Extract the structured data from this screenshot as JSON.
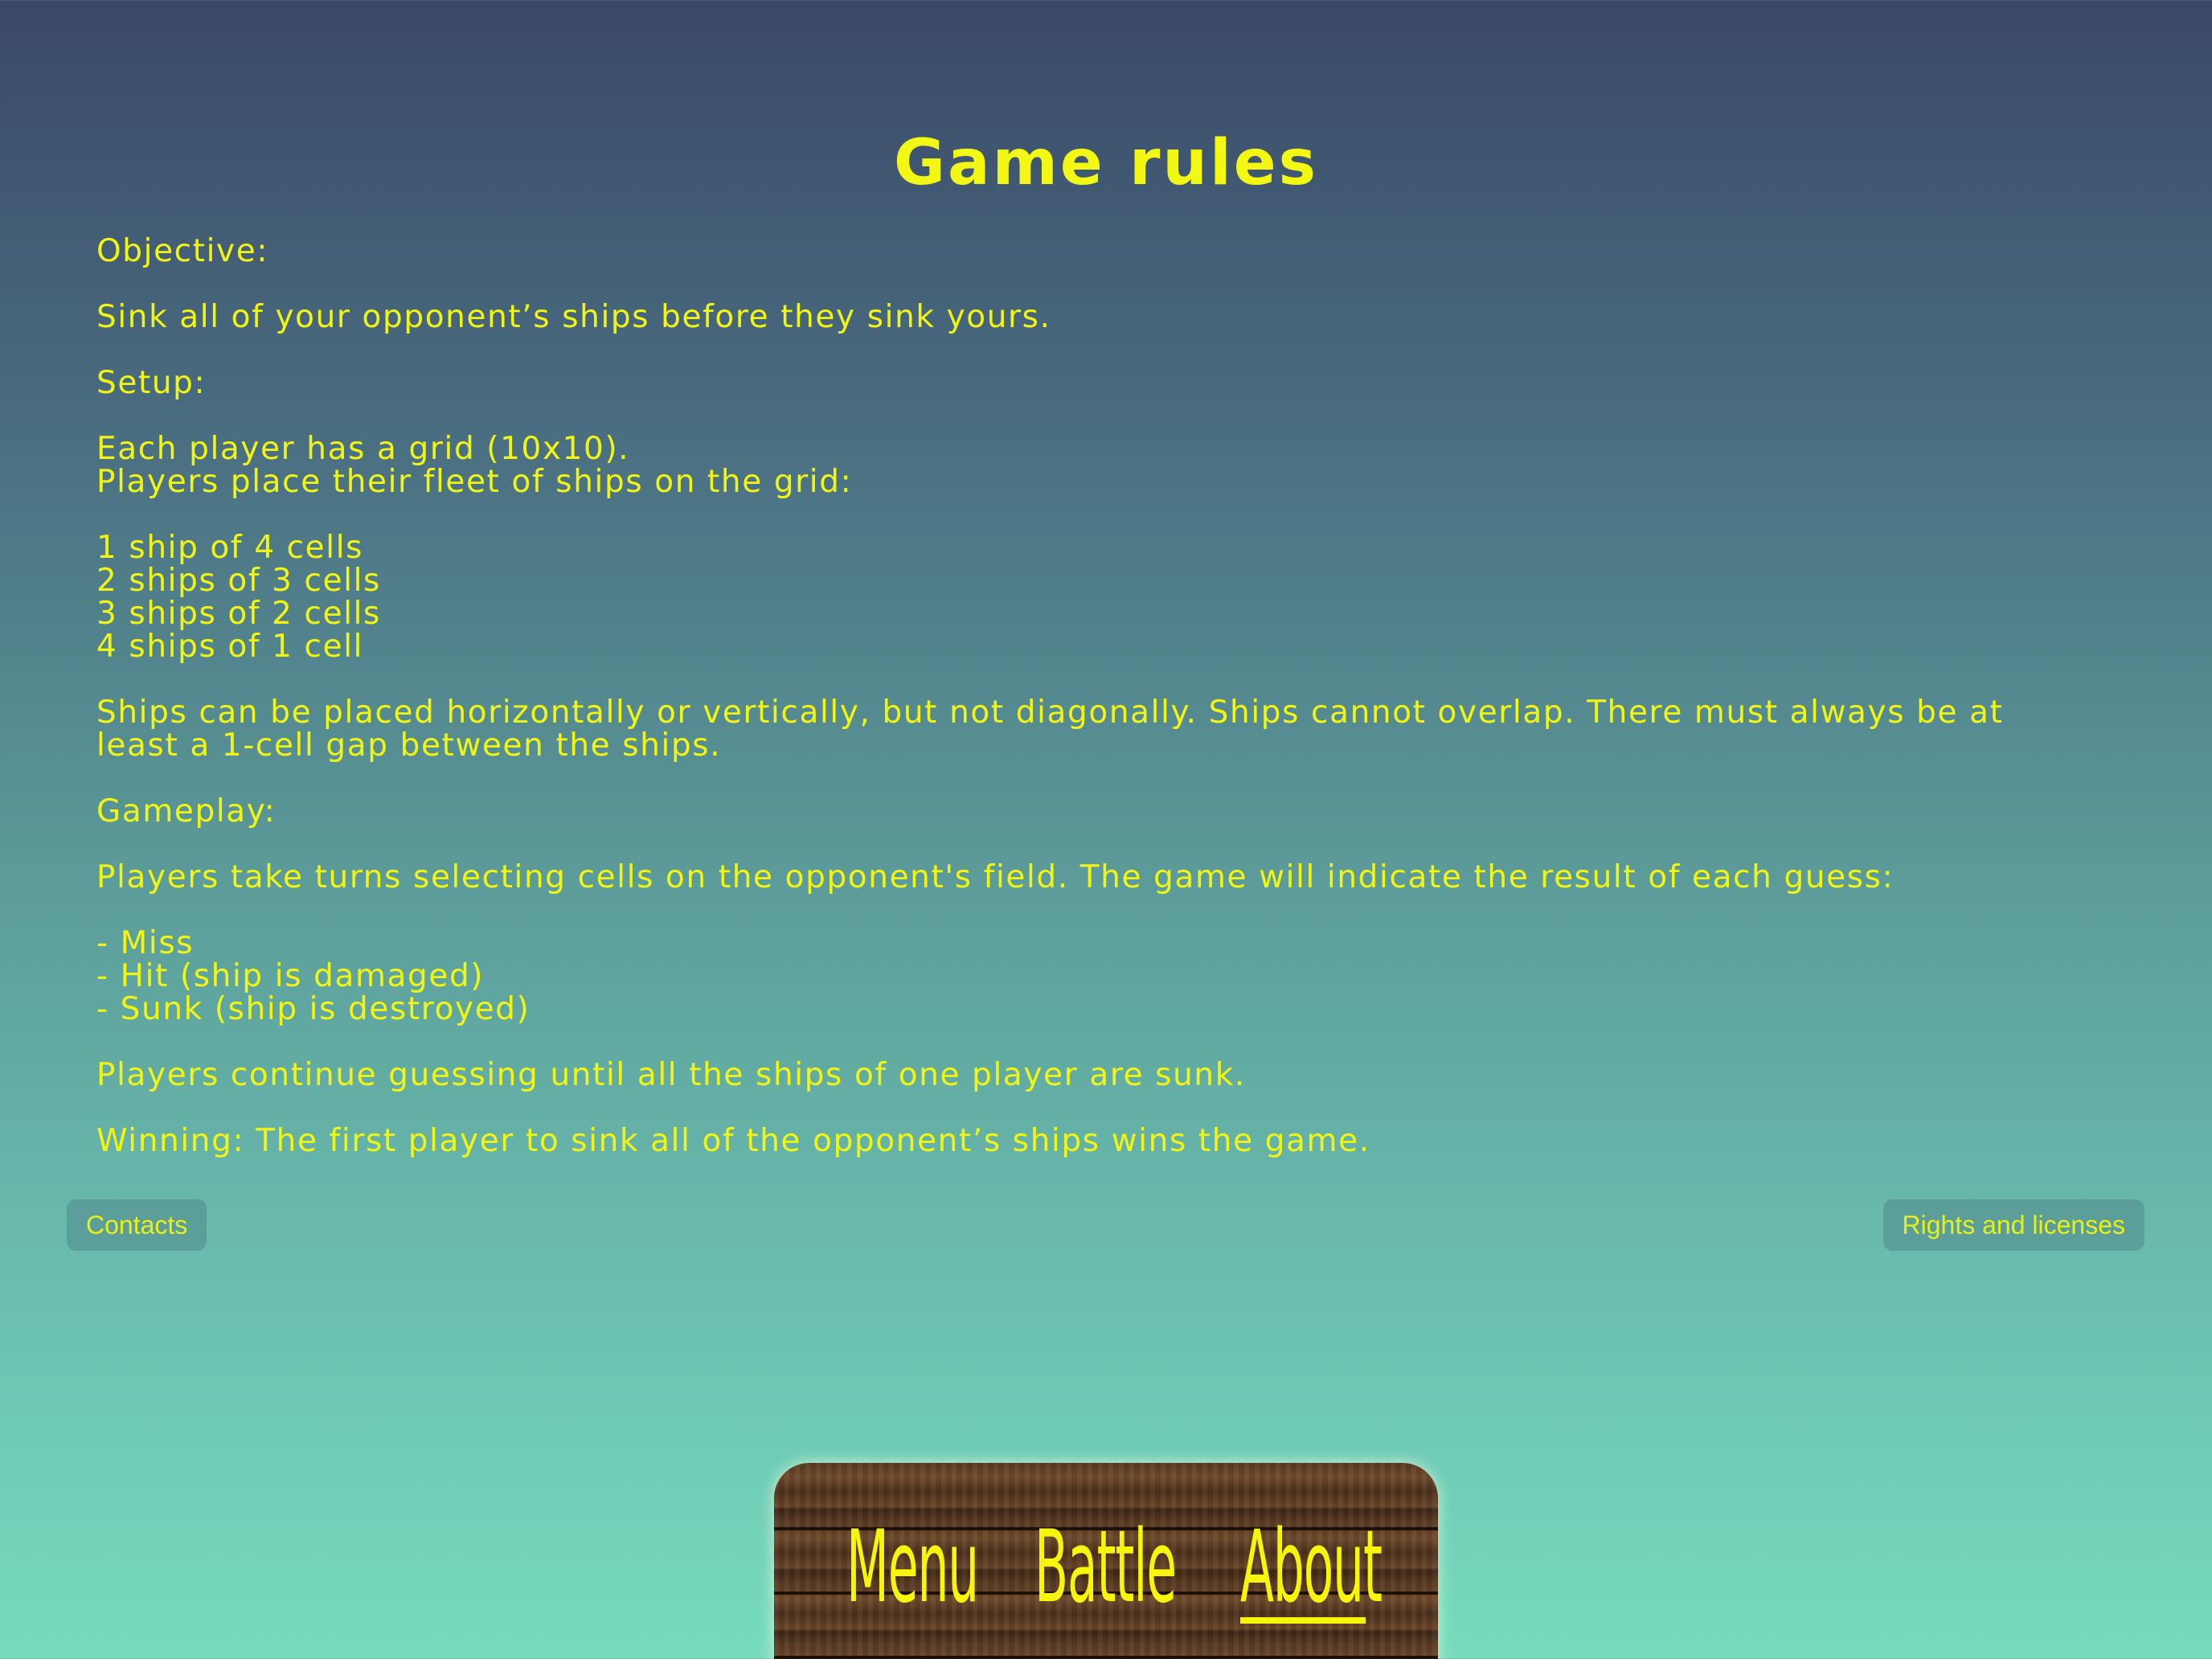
{
  "title": "Game rules",
  "rules": {
    "objective_heading": "Objective:",
    "objective_text": "Sink all of your opponent’s ships before they sink yours.",
    "setup_heading": "Setup:",
    "setup_line1": "Each player has a grid (10x10).",
    "setup_line2": "Players place their fleet of ships on the grid:",
    "fleet": [
      "1 ship of 4 cells",
      "2 ships of 3 cells",
      "3 ships of 2 cells",
      "4 ships of 1 cell"
    ],
    "placement_line1": "Ships can be placed horizontally or vertically, but not diagonally. Ships cannot overlap. There must always be at",
    "placement_line2": "least a 1-cell gap between the ships.",
    "gameplay_heading": "Gameplay:",
    "gameplay_text": "Players take turns selecting cells on the opponent's field. The game will indicate the result of each guess:",
    "results": [
      "- Miss",
      "- Hit (ship is damaged)",
      "- Sunk (ship is destroyed)"
    ],
    "continue_text": "Players continue guessing until all the ships of one player are sunk.",
    "winning_text": "Winning: The first player to sink all of the opponent’s ships wins the game."
  },
  "buttons": {
    "contacts": "Contacts",
    "rights": "Rights and licenses"
  },
  "tabs": {
    "menu": "Menu",
    "battle": "Battle",
    "about": "About",
    "selected": "About"
  },
  "colors": {
    "text": "#f0f514",
    "background_top": "#3a4866",
    "background_bottom": "#76dcbd"
  }
}
